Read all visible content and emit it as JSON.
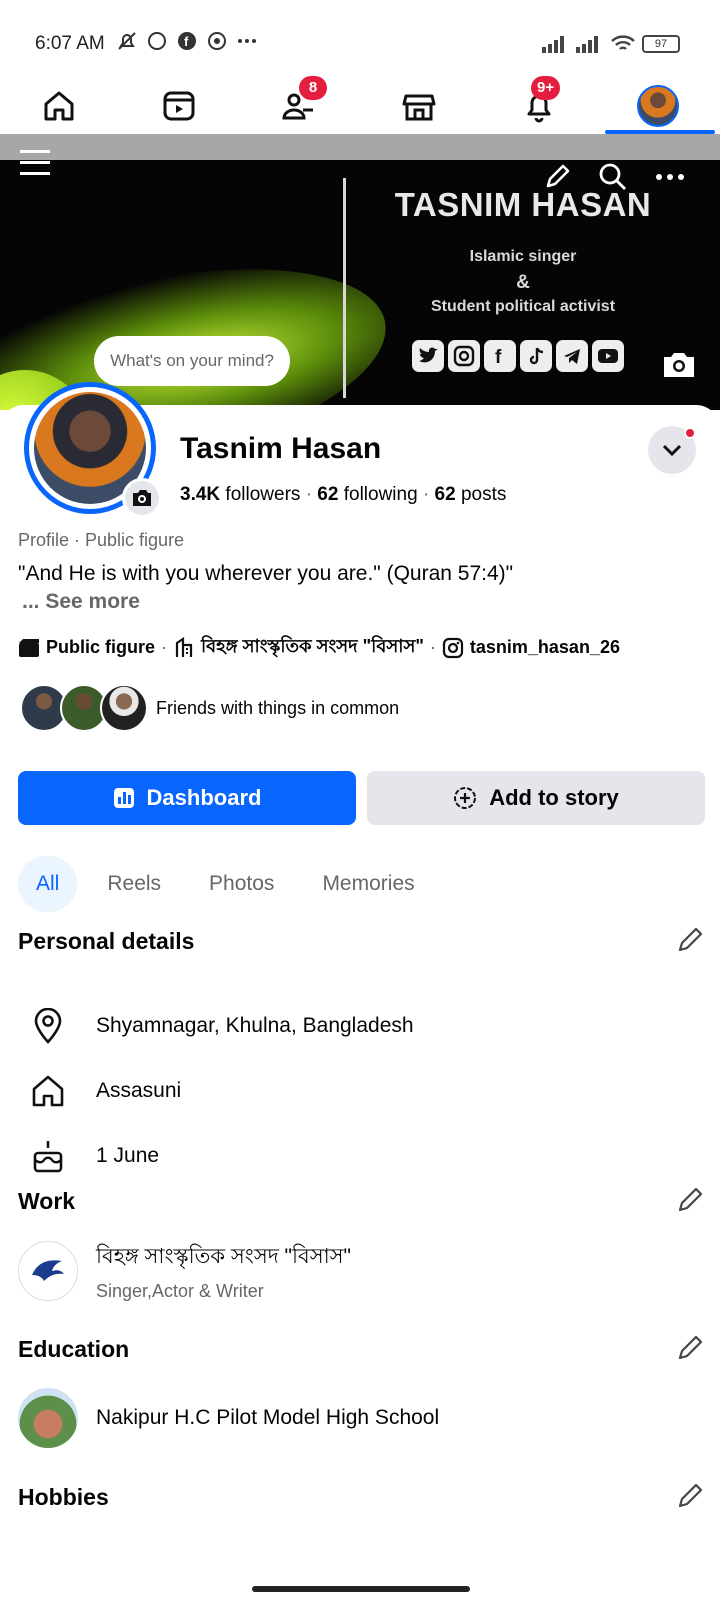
{
  "status_bar": {
    "time": "6:07 AM",
    "battery": "97"
  },
  "tabs": [
    {
      "name": "home",
      "badge": ""
    },
    {
      "name": "video",
      "badge": ""
    },
    {
      "name": "friends",
      "badge": "8"
    },
    {
      "name": "marketplace",
      "badge": ""
    },
    {
      "name": "notifications",
      "badge": "9+"
    },
    {
      "name": "profile",
      "badge": ""
    }
  ],
  "cover": {
    "title": "TASNIM HASAN",
    "line1": "Islamic singer",
    "line2": "&",
    "line3": "Student political activist",
    "mind_placeholder": "What's on your mind?"
  },
  "profile": {
    "name": "Tasnim Hasan",
    "followers_count": "3.4K",
    "followers_label": "followers",
    "following_count": "62",
    "following_label": "following",
    "posts_count": "62",
    "posts_label": "posts",
    "meta": "Profile · Public figure",
    "quote": "\"And He is with you wherever you are.\" (Quran 57:4)\"",
    "see_more": "... See more",
    "intro_category": "Public figure",
    "intro_org": "বিহঙ্গ সাংস্কৃতিক সংসদ \"বিসাস\"",
    "intro_instagram": "tasnim_hasan_26",
    "friends_text": "Friends with things in common"
  },
  "buttons": {
    "dashboard": "Dashboard",
    "add_story": "Add to story"
  },
  "chips": [
    "All",
    "Reels",
    "Photos",
    "Memories"
  ],
  "sections": {
    "personal_title": "Personal details",
    "location": "Shyamnagar, Khulna, Bangladesh",
    "hometown": "Assasuni",
    "birthday": "1 June",
    "work_title": "Work",
    "work_org": "বিহঙ্গ সাংস্কৃতিক সংসদ \"বিসাস\"",
    "work_role": "Singer,Actor & Writer",
    "education_title": "Education",
    "school": "Nakipur H.C Pilot Model High School",
    "hobbies_title": "Hobbies"
  },
  "colors": {
    "accent": "#0866ff",
    "badge": "#e41e3f",
    "chip_bg": "#ebf5ff"
  }
}
